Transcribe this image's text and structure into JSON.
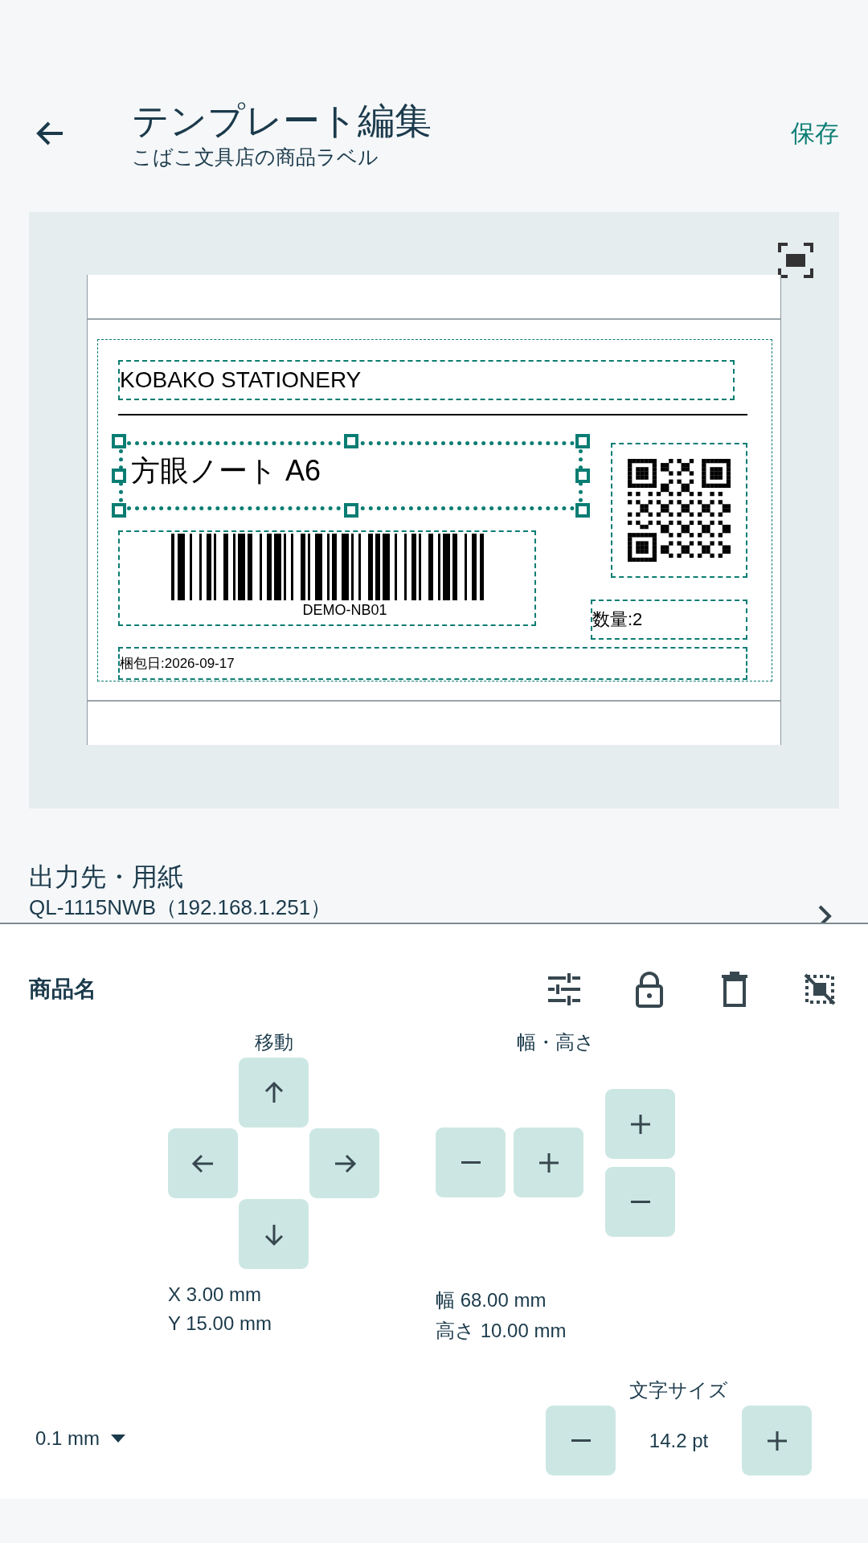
{
  "header": {
    "title": "テンプレート編集",
    "subtitle": "こばこ文具店の商品ラベル",
    "save": "保存"
  },
  "canvas": {
    "elements": [
      {
        "kind": "text",
        "text": "KOBAKO STATIONERY",
        "selected": false
      },
      {
        "kind": "rule"
      },
      {
        "kind": "text",
        "text": "方眼ノート A6",
        "selected": true
      },
      {
        "kind": "qr",
        "selected": false
      },
      {
        "kind": "barcode",
        "caption": "DEMO-NB01",
        "selected": false
      },
      {
        "kind": "text",
        "text": "数量:2",
        "selected": false
      },
      {
        "kind": "text",
        "text": "梱包日:2026-09-17",
        "selected": false
      }
    ]
  },
  "output": {
    "label": "出力先・用紙",
    "value": "QL-1115NWB（192.168.1.251）"
  },
  "panel": {
    "title": "商品名",
    "move": {
      "label": "移動",
      "x": "X 3.00 mm",
      "y": "Y 15.00 mm"
    },
    "size": {
      "label": "幅・高さ",
      "width": "幅 68.00 mm",
      "height": "高さ 10.00 mm"
    },
    "step": "0.1 mm",
    "font_size": {
      "label": "文字サイズ",
      "value": "14.2 pt"
    }
  }
}
